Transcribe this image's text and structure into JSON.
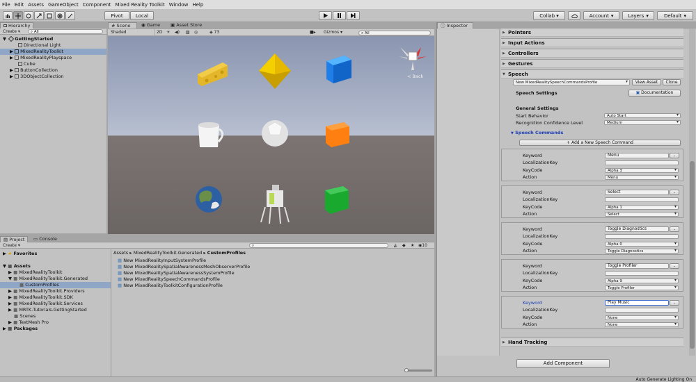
{
  "menu": [
    "File",
    "Edit",
    "Assets",
    "GameObject",
    "Component",
    "Mixed Reality Toolkit",
    "Window",
    "Help"
  ],
  "toolbar": {
    "pivot": "Pivot",
    "local": "Local",
    "collab": "Collab ▾",
    "account": "Account",
    "layers": "Layers",
    "layout": "Default"
  },
  "hierarchy": {
    "tab": "Hierarchy",
    "create": "Create ▾",
    "search_placeholder": "All",
    "scene": "GettingStarted",
    "items": [
      {
        "label": "Directional Light"
      },
      {
        "label": "MixedRealityToolkit"
      },
      {
        "label": "MixedRealityPlayspace"
      },
      {
        "label": "Cube"
      },
      {
        "label": "ButtonCollection"
      },
      {
        "label": "3DObjectCollection"
      }
    ]
  },
  "scene": {
    "tabs": [
      "Scene",
      "Game",
      "Asset Store"
    ],
    "shading": "Shaded",
    "mode_2d": "2D",
    "gizmos": "Gizmos ▾",
    "search": "All",
    "hidden_count": "73",
    "back_label": "< Back"
  },
  "project": {
    "tabs": [
      "Project",
      "Console"
    ],
    "create": "Create ▾",
    "favorites": "Favorites",
    "assets": "Assets",
    "tree": [
      "MixedRealityToolkit",
      "MixedRealityToolkit.Generated",
      "CustomProfiles",
      "MixedRealityToolkit.Providers",
      "MixedRealityToolkit.SDK",
      "MixedRealityToolkit.Services",
      "MRTK.Tutorials.GettingStarted",
      "Scenes",
      "TextMesh Pro"
    ],
    "packages": "Packages",
    "breadcrumb": [
      "Assets",
      "MixedRealityToolkit.Generated",
      "CustomProfiles"
    ],
    "files": [
      "New MixedRealityInputSystemProfile",
      "New MixedRealitySpatialAwarenessMeshObserverProfile",
      "New MixedRealitySpatialAwarenessSystemProfile",
      "New MixedRealitySpeechCommandsProfile",
      "New MixedRealityToolkitConfigurationProfile"
    ],
    "hidden_count": "10"
  },
  "inspector": {
    "tab": "Inspector",
    "sections": [
      "Pointers",
      "Input Actions",
      "Controllers",
      "Gestures"
    ],
    "speech": {
      "title": "Speech",
      "profile": "New MixedRealitySpeechCommandsProfile",
      "view_asset": "View Asset",
      "clone": "Clone",
      "settings_title": "Speech Settings",
      "documentation": "Documentation",
      "general_title": "General Settings",
      "start_behavior_label": "Start Behavior",
      "start_behavior": "Auto Start",
      "confidence_label": "Recognition Confidence Level",
      "confidence": "Medium",
      "commands_title": "Speech Commands",
      "add_button": "+ Add a New Speech Command",
      "labels": {
        "keyword": "Keyword",
        "localization": "LocalizationKey",
        "keycode": "KeyCode",
        "action": "Action"
      },
      "remove": "-",
      "commands": [
        {
          "keyword": "Menu",
          "localization": "",
          "keycode": "Alpha 3",
          "action": "Menu"
        },
        {
          "keyword": "Select",
          "localization": "",
          "keycode": "Alpha 1",
          "action": "Select"
        },
        {
          "keyword": "Toggle Diagnostics",
          "localization": "",
          "keycode": "Alpha 0",
          "action": "Toggle Diagnostics"
        },
        {
          "keyword": "Toggle Profiler",
          "localization": "",
          "keycode": "Alpha 9",
          "action": "Toggle Profiler"
        },
        {
          "keyword": "Play Music",
          "localization": "",
          "keycode": "None",
          "action": "None"
        }
      ]
    },
    "hand_tracking": "Hand Tracking",
    "add_component": "Add Component"
  },
  "status": {
    "text": "Auto Generate Lighting On"
  },
  "colors": {
    "selection": "#8fa6c6",
    "accent_blue": "#1c3fb5",
    "panel": "#c2c2c2"
  }
}
